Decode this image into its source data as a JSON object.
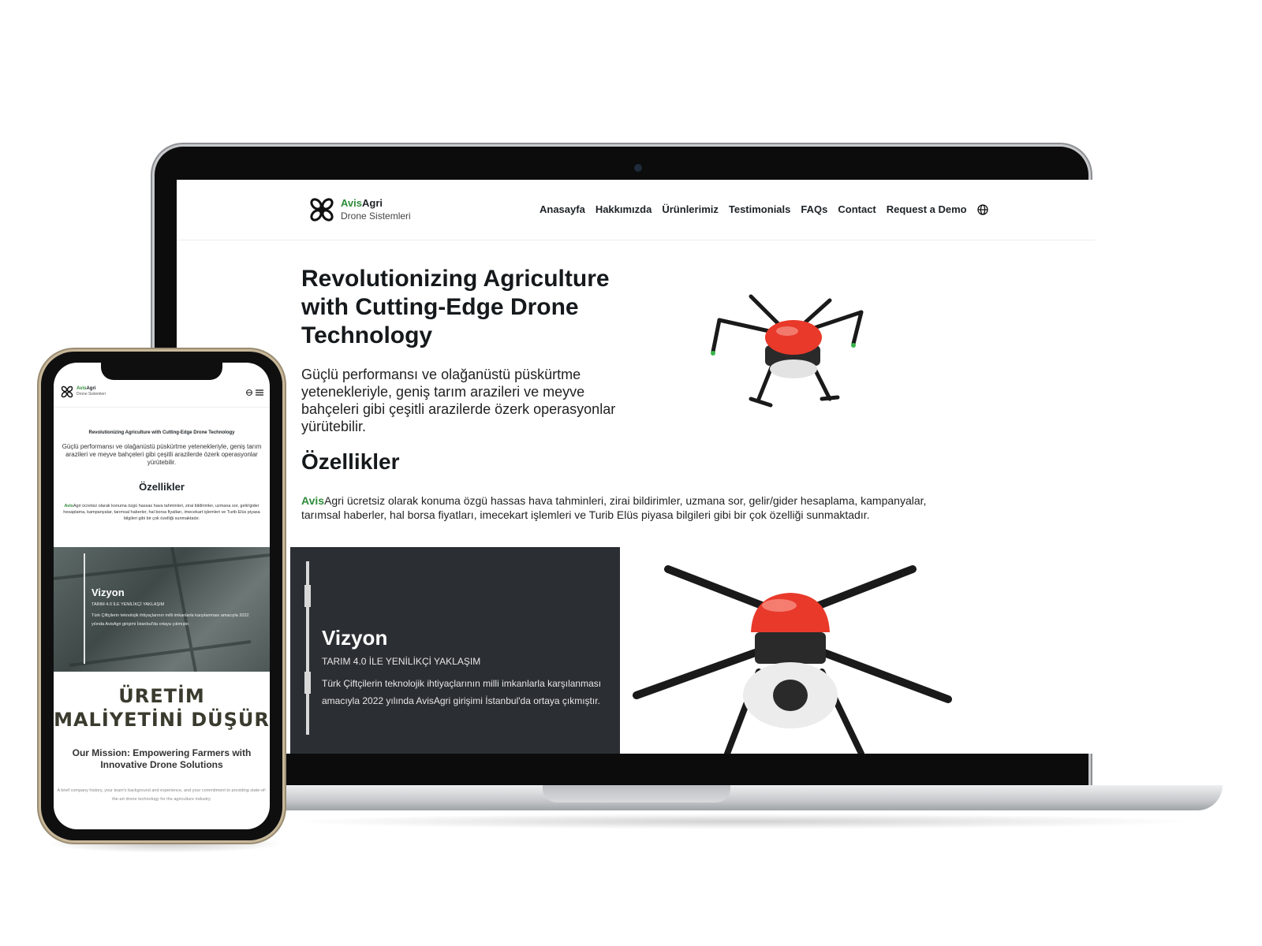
{
  "brand": {
    "name_part1": "Avis",
    "name_part2": "Agri",
    "subtitle": "Drone Sistemleri",
    "accent_color": "#2e8b3a"
  },
  "nav": {
    "items": [
      "Anasayfa",
      "Hakkımızda",
      "Ürünlerimiz",
      "Testimonials",
      "FAQs",
      "Contact",
      "Request a Demo"
    ],
    "language_icon": "globe-icon"
  },
  "hero": {
    "title": "Revolutionizing Agriculture with Cutting-Edge Drone Technology",
    "text": "Güçlü performansı ve olağanüstü püskürtme yetenekleriyle, geniş tarım arazileri ve meyve bahçeleri gibi çeşitli arazilerde özerk operasyonlar yürütebilir."
  },
  "features": {
    "title": "Özellikler",
    "brand_part1": "Avis",
    "text": "Agri ücretsiz olarak konuma özgü hassas hava tahminleri, zirai bildirimler, uzmana sor, gelir/gider hesaplama, kampanyalar, tarımsal haberler, hal borsa fiyatları, imecekart işlemleri ve Turib Elüs piyasa bilgileri gibi bir çok özelliği sunmaktadır."
  },
  "vision": {
    "title": "Vizyon",
    "subtitle": "TARIM 4.0 İLE YENİLİKÇİ YAKLAŞIM",
    "text": "Türk Çiftçilerin teknolojik ihtiyaçlarının milli imkanlarla karşılanması amacıyla 2022 yılında AvisAgri girişimi İstanbul'da ortaya çıkmıştır."
  },
  "mobile": {
    "hero_title": "Revolutionizing Agriculture with Cutting-Edge Drone Technology",
    "big_title": "ÜRETİM MALİYETİNİ DÜŞÜR",
    "mission": "Our Mission: Empowering Farmers with Innovative Drone Solutions",
    "brief": "A brief company history, your team's background and experience, and your commitment to providing state-of-the-art drone technology for the agriculture industry.",
    "menu_icon": "hamburger-menu-icon"
  },
  "colors": {
    "dark_panel": "#2b2f33",
    "drone_red": "#e8392a"
  }
}
